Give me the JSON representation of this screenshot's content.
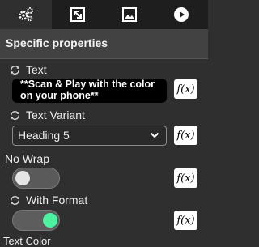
{
  "tabs": [
    {
      "icon": "gears-icon",
      "active": true
    },
    {
      "icon": "resize-icon",
      "active": false
    },
    {
      "icon": "image-icon",
      "active": false
    },
    {
      "icon": "play-icon",
      "active": false
    }
  ],
  "section": {
    "title": "Specific properties"
  },
  "properties": {
    "text": {
      "label": "Text",
      "value_line1": "**Scan & Play with the color",
      "value_line2": "on your phone**",
      "fx": "f(x)"
    },
    "text_variant": {
      "label": "Text Variant",
      "value": "Heading 5",
      "fx": "f(x)"
    },
    "no_wrap": {
      "label": "No Wrap",
      "state": "off",
      "fx": "f(x)"
    },
    "with_format": {
      "label": "With Format",
      "state": "on",
      "fx": "f(x)"
    },
    "text_color": {
      "label": "Text Color"
    }
  },
  "colors": {
    "accent": "#4cf2a0",
    "background": "#2f2f2f",
    "tabbar": "#1e1e1e",
    "header": "#424242"
  }
}
